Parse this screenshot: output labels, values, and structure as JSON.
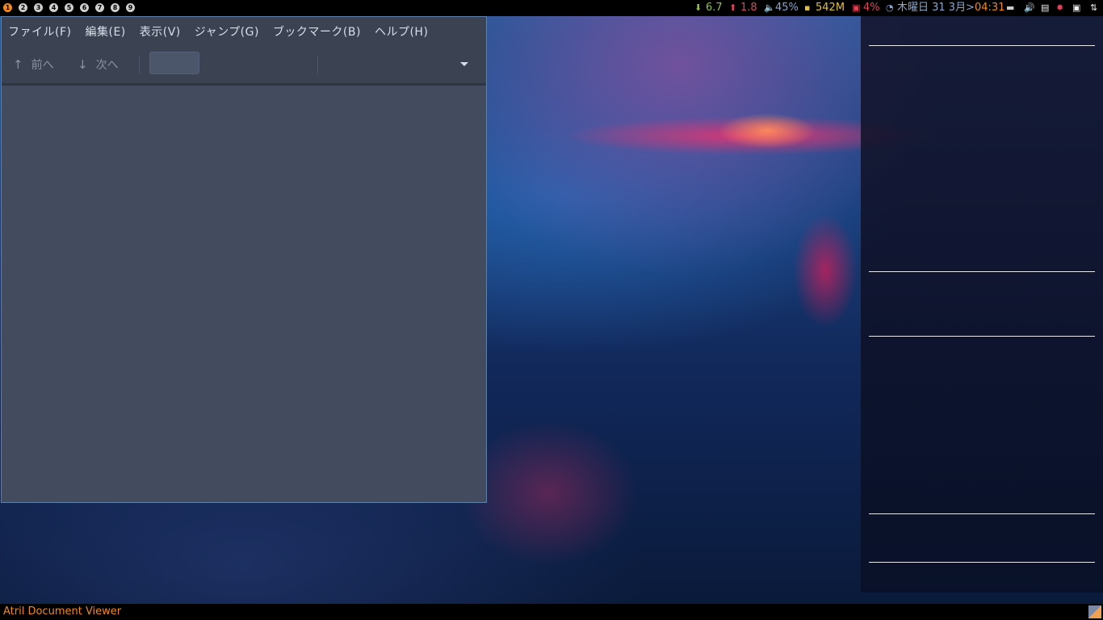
{
  "topbar": {
    "workspaces": [
      "1",
      "2",
      "3",
      "4",
      "5",
      "6",
      "7",
      "8",
      "9"
    ],
    "active_workspace": "1",
    "net_down": "6.7",
    "net_up": "1.8",
    "volume": "45%",
    "memory": "542M",
    "cpu": "4%",
    "date": "木曜日 31 3月",
    "time_sep": ">",
    "time": "04:31",
    "colors": {
      "down": "#8fbf4a",
      "up": "#e0435a",
      "volume": "#8aa6d0",
      "memory": "#e0c040",
      "cpu": "#e0435a",
      "date": "#8aa6d0",
      "time": "#f08a1c"
    }
  },
  "atril": {
    "menu": [
      "ファイル(F)",
      "編集(E)",
      "表示(V)",
      "ジャンプ(G)",
      "ブックマーク(B)",
      "ヘルプ(H)"
    ],
    "toolbar": {
      "prev_label": "前へ",
      "next_label": "次へ",
      "page_value": ""
    }
  },
  "bottombar": {
    "window_title": "Atril Document Viewer"
  }
}
